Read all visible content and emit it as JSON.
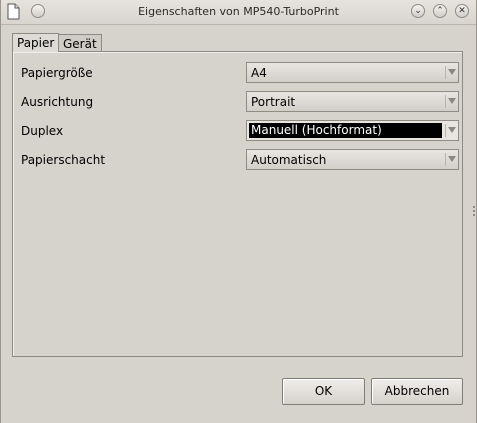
{
  "window": {
    "title": "Eigenschaften von MP540-TurboPrint"
  },
  "tabs": [
    {
      "label": "Papier",
      "active": true
    },
    {
      "label": "Gerät",
      "active": false
    }
  ],
  "fields": [
    {
      "label": "Papiergröße",
      "mnemonic": "P",
      "value": "A4"
    },
    {
      "label": "Ausrichtung",
      "mnemonic": "A",
      "value": "Portrait"
    },
    {
      "label": "Duplex",
      "mnemonic": "D",
      "value": "Manuell (Hochformat)"
    },
    {
      "label": "Papierschacht",
      "mnemonic": "i",
      "value": "Automatisch"
    }
  ],
  "buttons": {
    "ok": "OK",
    "cancel": "Abbrechen"
  },
  "icons": {
    "document": "document-icon",
    "window_menu": "window-menu-icon",
    "minimize": "chevron-down-icon",
    "maximize": "chevron-up-icon",
    "close": "close-icon"
  },
  "colors": {
    "selection": "#000000",
    "window_bg": "#d6d2cc"
  }
}
